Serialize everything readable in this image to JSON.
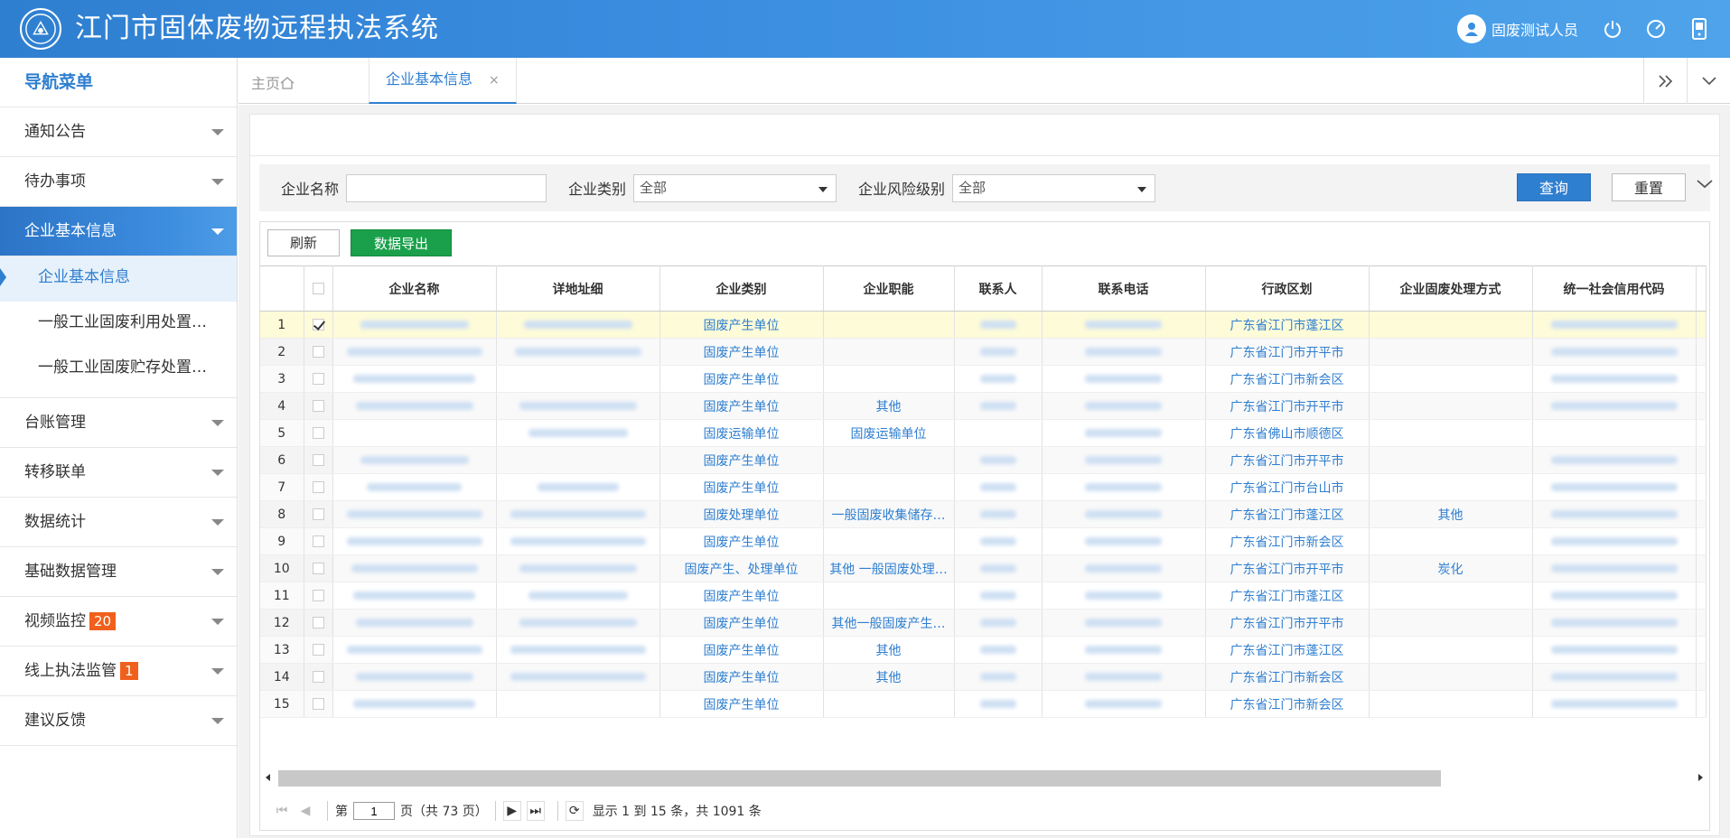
{
  "app": {
    "title": "江门市固体废物远程执法系统"
  },
  "header": {
    "user_name": "固废测试人员"
  },
  "sidebar": {
    "title": "导航菜单",
    "items": [
      {
        "label": "通知公告"
      },
      {
        "label": "待办事项"
      },
      {
        "label": "企业基本信息"
      },
      {
        "label": "台账管理"
      },
      {
        "label": "转移联单"
      },
      {
        "label": "数据统计"
      },
      {
        "label": "基础数据管理"
      },
      {
        "label": "视频监控",
        "badge": "20"
      },
      {
        "label": "线上执法监管",
        "badge": "1"
      },
      {
        "label": "建议反馈"
      }
    ],
    "subitems": [
      {
        "label": "企业基本信息"
      },
      {
        "label": "一般工业固废利用处置…"
      },
      {
        "label": "一般工业固废贮存处置…"
      }
    ]
  },
  "tabs": {
    "home": "主页",
    "active": "企业基本信息",
    "close": "×"
  },
  "search": {
    "name_label": "企业名称",
    "name_value": "",
    "type_label": "企业类别",
    "type_value": "全部",
    "risk_label": "企业风险级别",
    "risk_value": "全部",
    "query_label": "查询",
    "reset_label": "重置"
  },
  "toolbar": {
    "refresh_label": "刷新",
    "export_label": "数据导出"
  },
  "table": {
    "columns": [
      "企业名称",
      "详地址细",
      "企业类别",
      "企业职能",
      "联系人",
      "联系电话",
      "行政区划",
      "企业固废处理方式",
      "统一社会信用代码"
    ],
    "rows": [
      {
        "n": "1",
        "checked": true,
        "type": "固废产生单位",
        "func": "",
        "region": "广东省江门市蓬江区",
        "method": ""
      },
      {
        "n": "2",
        "checked": false,
        "type": "固废产生单位",
        "func": "",
        "region": "广东省江门市开平市",
        "method": ""
      },
      {
        "n": "3",
        "checked": false,
        "type": "固废产生单位",
        "func": "",
        "region": "广东省江门市新会区",
        "method": ""
      },
      {
        "n": "4",
        "checked": false,
        "type": "固废产生单位",
        "func": "其他",
        "region": "广东省江门市开平市",
        "method": ""
      },
      {
        "n": "5",
        "checked": false,
        "type": "固废运输单位",
        "func": "固废运输单位",
        "region": "广东省佛山市顺德区",
        "method": ""
      },
      {
        "n": "6",
        "checked": false,
        "type": "固废产生单位",
        "func": "",
        "region": "广东省江门市开平市",
        "method": ""
      },
      {
        "n": "7",
        "checked": false,
        "type": "固废产生单位",
        "func": "",
        "region": "广东省江门市台山市",
        "method": ""
      },
      {
        "n": "8",
        "checked": false,
        "type": "固废处理单位",
        "func": "一般固废收集储存…",
        "region": "广东省江门市蓬江区",
        "method": "其他"
      },
      {
        "n": "9",
        "checked": false,
        "type": "固废产生单位",
        "func": "",
        "region": "广东省江门市新会区",
        "method": ""
      },
      {
        "n": "10",
        "checked": false,
        "type": "固废产生、处理单位",
        "func": "其他 一般固废处理…",
        "region": "广东省江门市开平市",
        "method": "炭化"
      },
      {
        "n": "11",
        "checked": false,
        "type": "固废产生单位",
        "func": "",
        "region": "广东省江门市蓬江区",
        "method": ""
      },
      {
        "n": "12",
        "checked": false,
        "type": "固废产生单位",
        "func": "其他一般固废产生…",
        "region": "广东省江门市开平市",
        "method": ""
      },
      {
        "n": "13",
        "checked": false,
        "type": "固废产生单位",
        "func": "其他",
        "region": "广东省江门市蓬江区",
        "method": ""
      },
      {
        "n": "14",
        "checked": false,
        "type": "固废产生单位",
        "func": "其他",
        "region": "广东省江门市新会区",
        "method": ""
      },
      {
        "n": "15",
        "checked": false,
        "type": "固废产生单位",
        "func": "",
        "region": "广东省江门市新会区",
        "method": ""
      }
    ]
  },
  "pager": {
    "page_prefix": "第",
    "page_value": "1",
    "page_suffix": "页（共 73 页）",
    "summary": "显示 1 到 15 条，共 1091 条"
  },
  "colors": {
    "primary": "#2f7fd0",
    "export": "#1aa04a",
    "badge": "#f0601c",
    "selected_row": "#fdfbd8"
  }
}
